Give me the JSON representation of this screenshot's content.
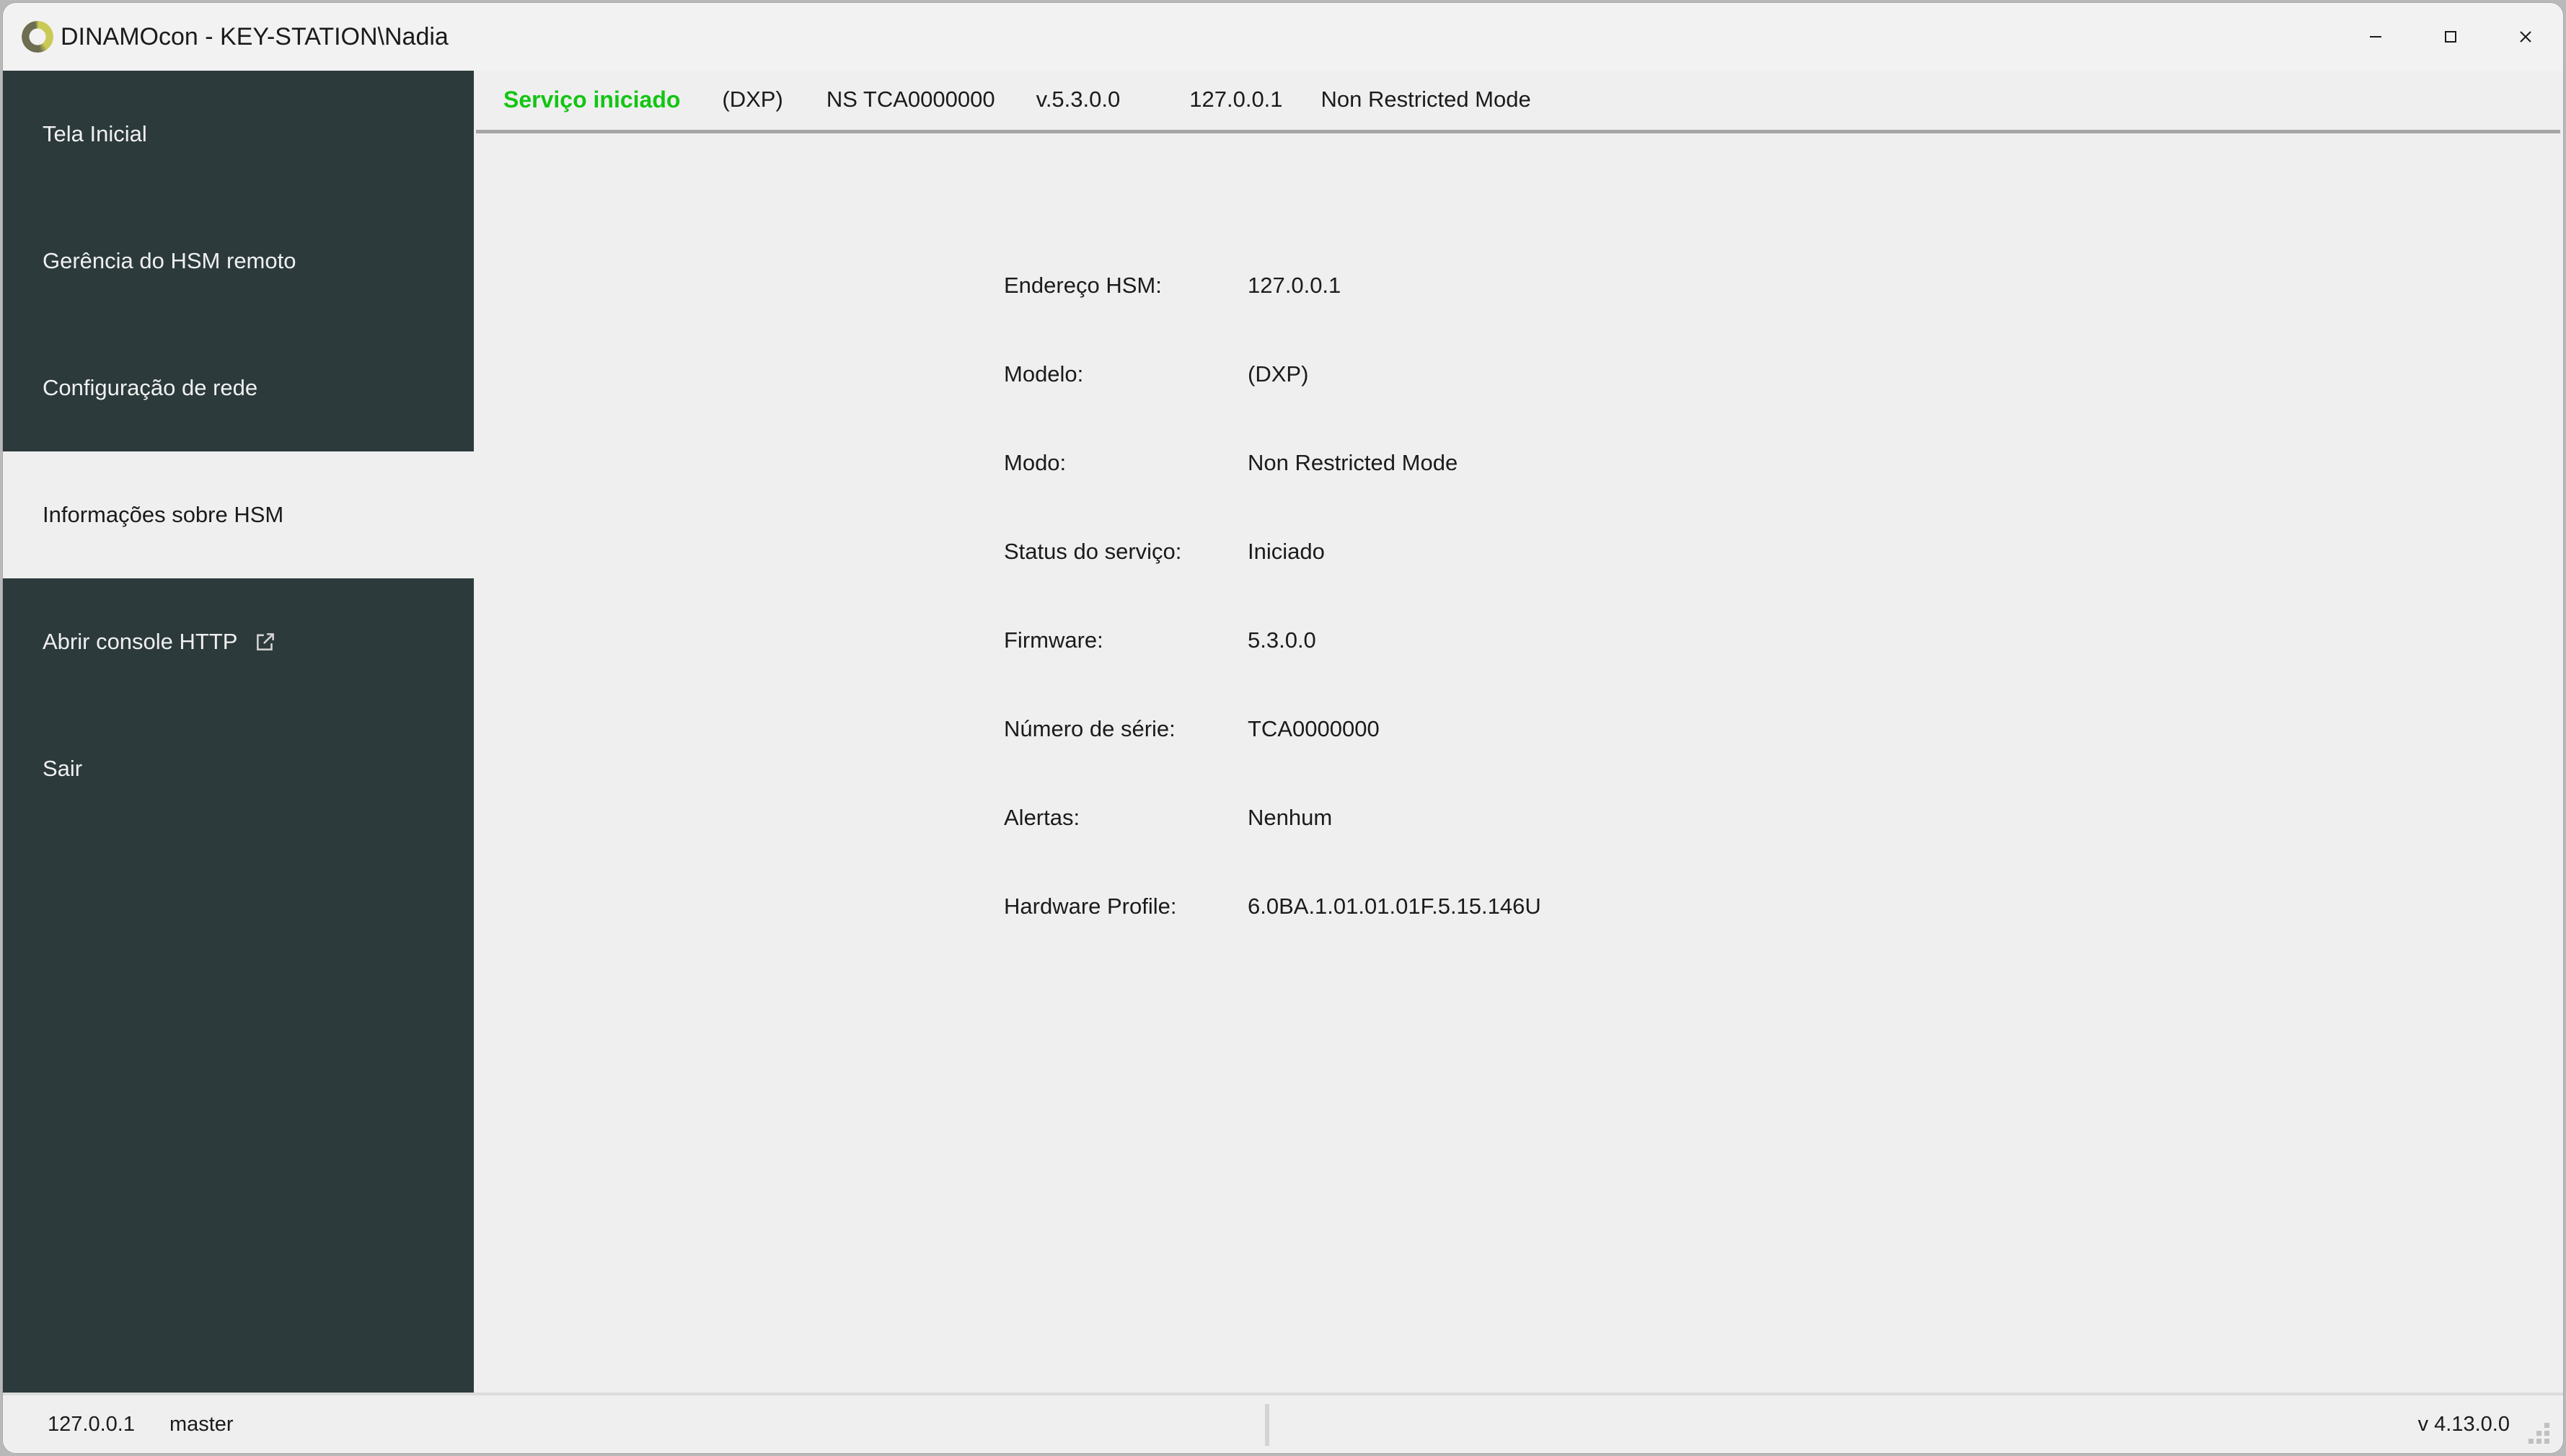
{
  "window": {
    "title": "DINAMOcon - KEY-STATION\\Nadia",
    "logo_icon": "dinamo-ring-logo",
    "controls": {
      "minimize": "minimize-icon",
      "maximize": "maximize-icon",
      "close": "close-icon"
    }
  },
  "sidebar": {
    "items": [
      {
        "label": "Tela Inicial",
        "selected": false
      },
      {
        "label": "Gerência do HSM remoto",
        "selected": false
      },
      {
        "label": "Configuração de rede",
        "selected": false
      },
      {
        "label": "Informações sobre HSM",
        "selected": true
      },
      {
        "label": "Abrir console HTTP",
        "selected": false,
        "icon": "external-link-icon"
      },
      {
        "label": "Sair",
        "selected": false
      }
    ]
  },
  "status_header": {
    "service_state": "Serviço iniciado",
    "model": "(DXP)",
    "serial": "NS TCA0000000",
    "version": "v.5.3.0.0",
    "address": "127.0.0.1",
    "mode": "Non Restricted Mode",
    "accent_color": "#13c513"
  },
  "hsm_info": {
    "rows": [
      {
        "label": "Endereço HSM:",
        "value": "127.0.0.1"
      },
      {
        "label": "Modelo:",
        "value": "(DXP)"
      },
      {
        "label": "Modo:",
        "value": "Non Restricted Mode"
      },
      {
        "label": "Status do serviço:",
        "value": "Iniciado"
      },
      {
        "label": "Firmware:",
        "value": "5.3.0.0"
      },
      {
        "label": "Número de série:",
        "value": "TCA0000000"
      },
      {
        "label": "Alertas:",
        "value": "Nenhum"
      },
      {
        "label": "Hardware Profile:",
        "value": "6.0BA.1.01.01.01F.5.15.146U"
      }
    ]
  },
  "statusbar": {
    "address": "127.0.0.1",
    "user": "master",
    "app_version": "v 4.13.0.0"
  }
}
